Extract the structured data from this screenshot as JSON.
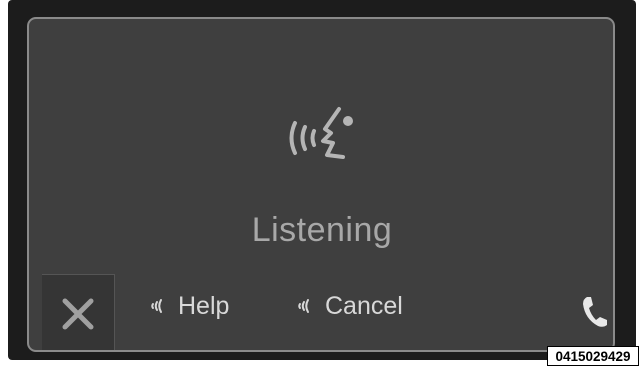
{
  "voice_screen": {
    "status": "Listening",
    "status_icon": "voice-speaking-icon",
    "commands": [
      {
        "label": "Help",
        "icon": "voice-cue-icon"
      },
      {
        "label": "Cancel",
        "icon": "voice-cue-icon"
      }
    ],
    "close_icon": "close-x-icon",
    "phone_icon": "phone-handset-icon"
  },
  "figure": {
    "id": "0415029429"
  },
  "colors": {
    "screen_bg": "#3f3f3f",
    "bezel": "#1c1c1c",
    "text_primary": "#d8d8d8",
    "text_status": "#a8a8a8"
  }
}
